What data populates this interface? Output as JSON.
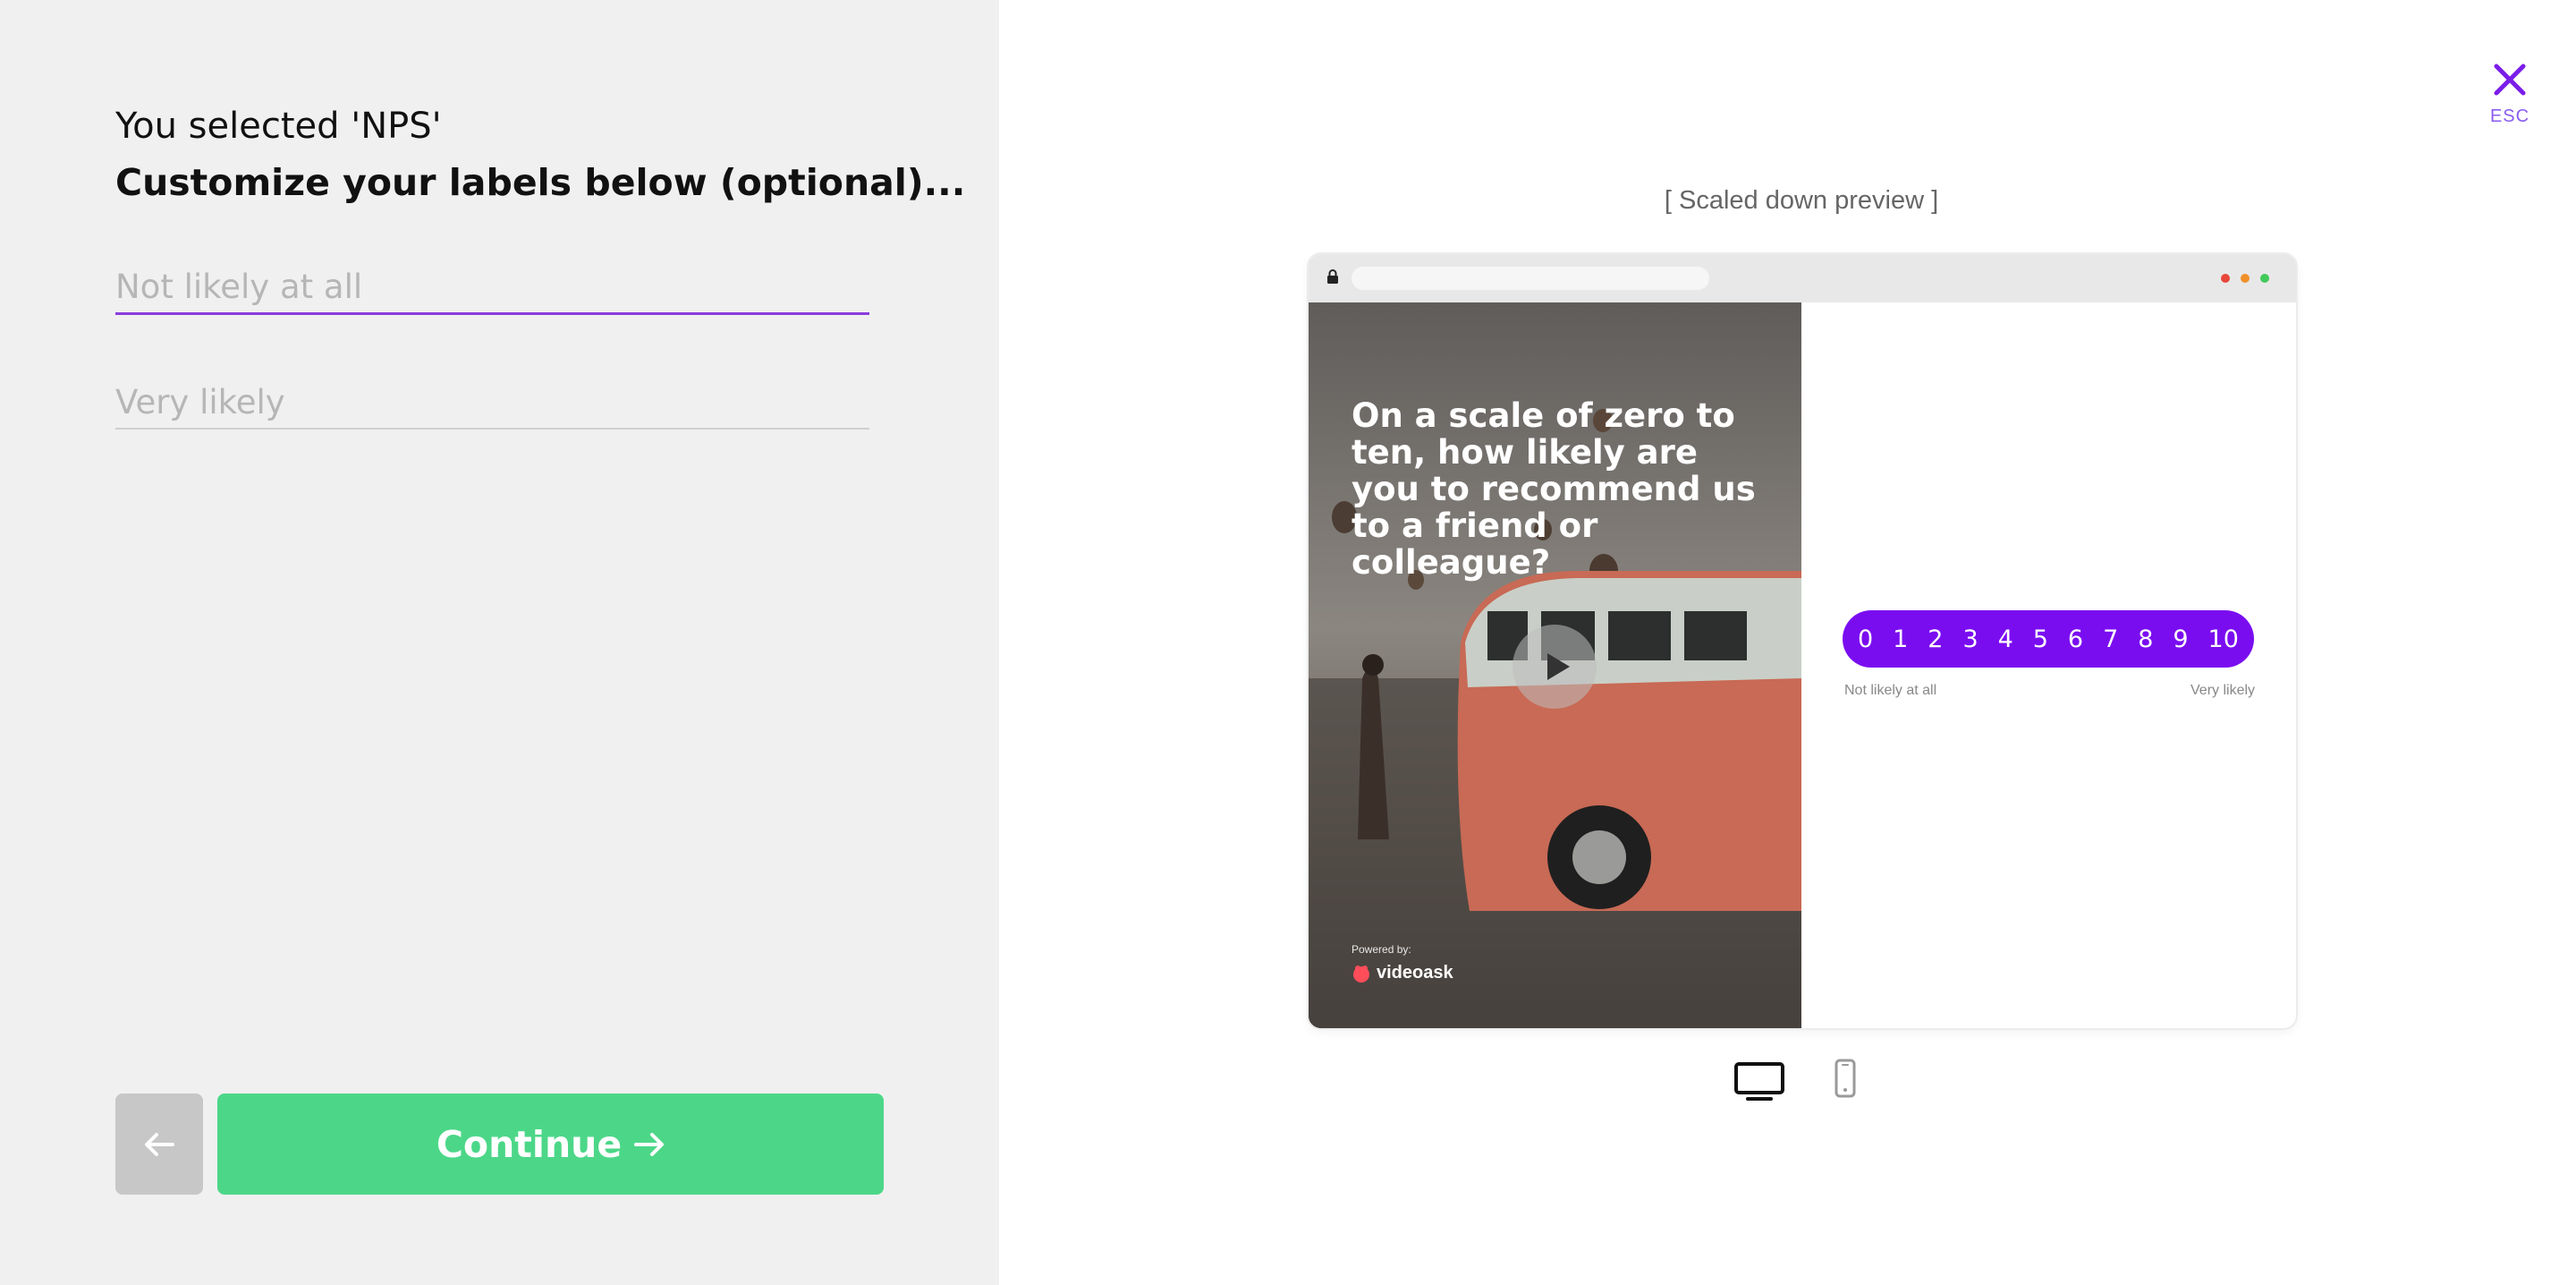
{
  "editor": {
    "selected_text": "You selected 'NPS'",
    "instruction": "Customize your labels below (optional)...",
    "low_label_placeholder": "Not likely at all",
    "high_label_placeholder": "Very likely",
    "continue_label": "Continue"
  },
  "close": {
    "esc_label": "ESC"
  },
  "preview": {
    "caption": "[ Scaled down preview ]",
    "question": "On a scale of zero to ten, how likely are you to recommend us to a friend or colleague?",
    "powered_by": "Powered by:",
    "brand": "videoask",
    "scale": [
      "0",
      "1",
      "2",
      "3",
      "4",
      "5",
      "6",
      "7",
      "8",
      "9",
      "10"
    ],
    "low_label": "Not likely at all",
    "high_label": "Very likely"
  },
  "devices": {
    "active": "desktop",
    "options": [
      "desktop-icon",
      "mobile-icon"
    ]
  },
  "colors": {
    "accent": "#7a0df0",
    "continue": "#4cd788",
    "left_bg": "#f0f0f0",
    "underline_active": "#8a3ddc"
  }
}
